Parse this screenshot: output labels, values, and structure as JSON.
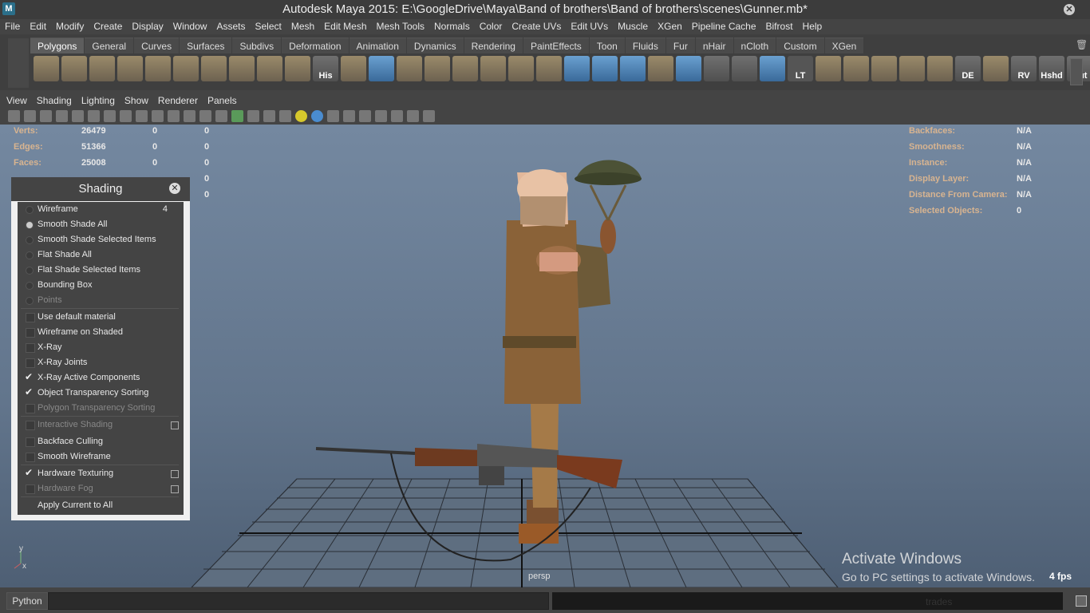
{
  "window": {
    "title": "Autodesk Maya 2015: E:\\GoogleDrive\\Maya\\Band of brothers\\Band of brothers\\scenes\\Gunner.mb*",
    "app_icon": "maya-icon"
  },
  "menubar": [
    "File",
    "Edit",
    "Modify",
    "Create",
    "Display",
    "Window",
    "Assets",
    "Select",
    "Mesh",
    "Edit Mesh",
    "Mesh Tools",
    "Normals",
    "Color",
    "Create UVs",
    "Edit UVs",
    "Muscle",
    "XGen",
    "Pipeline Cache",
    "Bifrost",
    "Help"
  ],
  "shelf": {
    "tabs": [
      "Polygons",
      "General",
      "Curves",
      "Surfaces",
      "Subdivs",
      "Deformation",
      "Animation",
      "Dynamics",
      "Rendering",
      "PaintEffects",
      "Toon",
      "Fluids",
      "Fur",
      "nHair",
      "nCloth",
      "Custom",
      "XGen"
    ],
    "active_tab": "Polygons",
    "icon_labels": {
      "his": "His",
      "lt": "LT",
      "de": "DE",
      "rv": "RV",
      "hshd": "Hshd",
      "out": "Out"
    }
  },
  "panel_menu": [
    "View",
    "Shading",
    "Lighting",
    "Show",
    "Renderer",
    "Panels"
  ],
  "hud": {
    "left": [
      {
        "label": "Verts:",
        "v1": "26479",
        "v2": "0",
        "v3": "0"
      },
      {
        "label": "Edges:",
        "v1": "51366",
        "v2": "0",
        "v3": "0"
      },
      {
        "label": "Faces:",
        "v1": "25008",
        "v2": "0",
        "v3": "0"
      },
      {
        "v3": "0"
      },
      {
        "v3": "0"
      }
    ],
    "right": [
      {
        "label": "Backfaces:",
        "value": "N/A"
      },
      {
        "label": "Smoothness:",
        "value": "N/A"
      },
      {
        "label": "Instance:",
        "value": "N/A"
      },
      {
        "label": "Display Layer:",
        "value": "N/A"
      },
      {
        "label": "Distance From Camera:",
        "value": "N/A"
      },
      {
        "label": "Selected Objects:",
        "value": "0"
      }
    ]
  },
  "shading_panel": {
    "title": "Shading",
    "items": [
      {
        "label": "Wireframe",
        "hotkey": "4"
      },
      {
        "label": "Smooth Shade All"
      },
      {
        "label": "Smooth Shade Selected Items"
      },
      {
        "label": "Flat Shade All"
      },
      {
        "label": "Flat Shade Selected Items"
      },
      {
        "label": "Bounding Box"
      },
      {
        "label": "Points"
      },
      {
        "label": "Use default material"
      },
      {
        "label": "Wireframe on Shaded"
      },
      {
        "label": "X-Ray"
      },
      {
        "label": "X-Ray Joints"
      },
      {
        "label": "X-Ray Active Components"
      },
      {
        "label": "Object Transparency Sorting"
      },
      {
        "label": "Polygon Transparency Sorting"
      },
      {
        "label": "Interactive Shading"
      },
      {
        "label": "Backface Culling"
      },
      {
        "label": "Smooth Wireframe"
      },
      {
        "label": "Hardware Texturing"
      },
      {
        "label": "Hardware Fog"
      },
      {
        "label": "Apply Current to All"
      }
    ]
  },
  "viewport": {
    "camera": "persp",
    "fps": "4 fps",
    "axis_y": "y",
    "axis_x": "x"
  },
  "activation": {
    "title": "Activate Windows",
    "subtitle": "Go to PC settings to activate Windows."
  },
  "command_line": {
    "language": "Python",
    "result_text": "trades"
  }
}
